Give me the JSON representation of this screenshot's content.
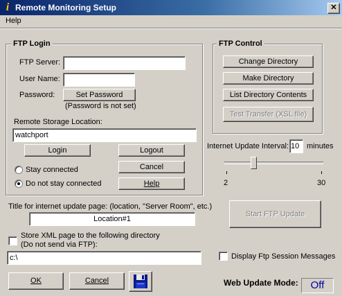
{
  "window": {
    "title": "Remote Monitoring Setup",
    "close_glyph": "✕"
  },
  "menu": {
    "items": [
      "Help"
    ]
  },
  "ftp_login": {
    "title": "FTP Login",
    "server_label": "FTP Server:",
    "server_value": "",
    "user_label": "User Name:",
    "user_value": "",
    "password_label": "Password:",
    "set_password_button": "Set Password",
    "password_status": "(Password is not set)",
    "storage_label": "Remote Storage Location:",
    "storage_value": "watchport",
    "login_button": "Login",
    "logout_button": "Logout",
    "cancel_button": "Cancel",
    "help_button": "Help",
    "stay_connected_label": "Stay connected",
    "not_stay_connected_label": "Do not stay connected",
    "selected_option": "Do not stay connected"
  },
  "ftp_control": {
    "title": "FTP Control",
    "change_dir_button": "Change Directory",
    "make_dir_button": "Make Directory",
    "list_dir_button": "List Directory Contents",
    "test_transfer_button": "Test Transfer (XSL file)"
  },
  "update_interval": {
    "label": "Internet Update Interval:",
    "value": "10",
    "unit": "minutes",
    "slider_min": "2",
    "slider_max": "30",
    "slider_value": 10
  },
  "page_title": {
    "label": "Title for internet update page: (location, \"Server Room\", etc.)",
    "value": "Location#1"
  },
  "start_ftp_button": "Start FTP Update",
  "store_xml": {
    "label_line1": "Store XML page to the following directory",
    "label_line2": "(Do not send via FTP):",
    "checked": false,
    "directory_value": "c:\\"
  },
  "display_ftp_messages": {
    "label": "Display Ftp Session Messages",
    "checked": false
  },
  "footer": {
    "ok_button": "OK",
    "cancel_button": "Cancel",
    "save_icon": "floppy-disk-icon",
    "web_update_label": "Web Update Mode:",
    "web_update_value": "Off"
  },
  "colors": {
    "titlebar_start": "#0a246a",
    "titlebar_end": "#a6caf0",
    "face": "#d4d0c8",
    "status_text": "#0000a0"
  }
}
